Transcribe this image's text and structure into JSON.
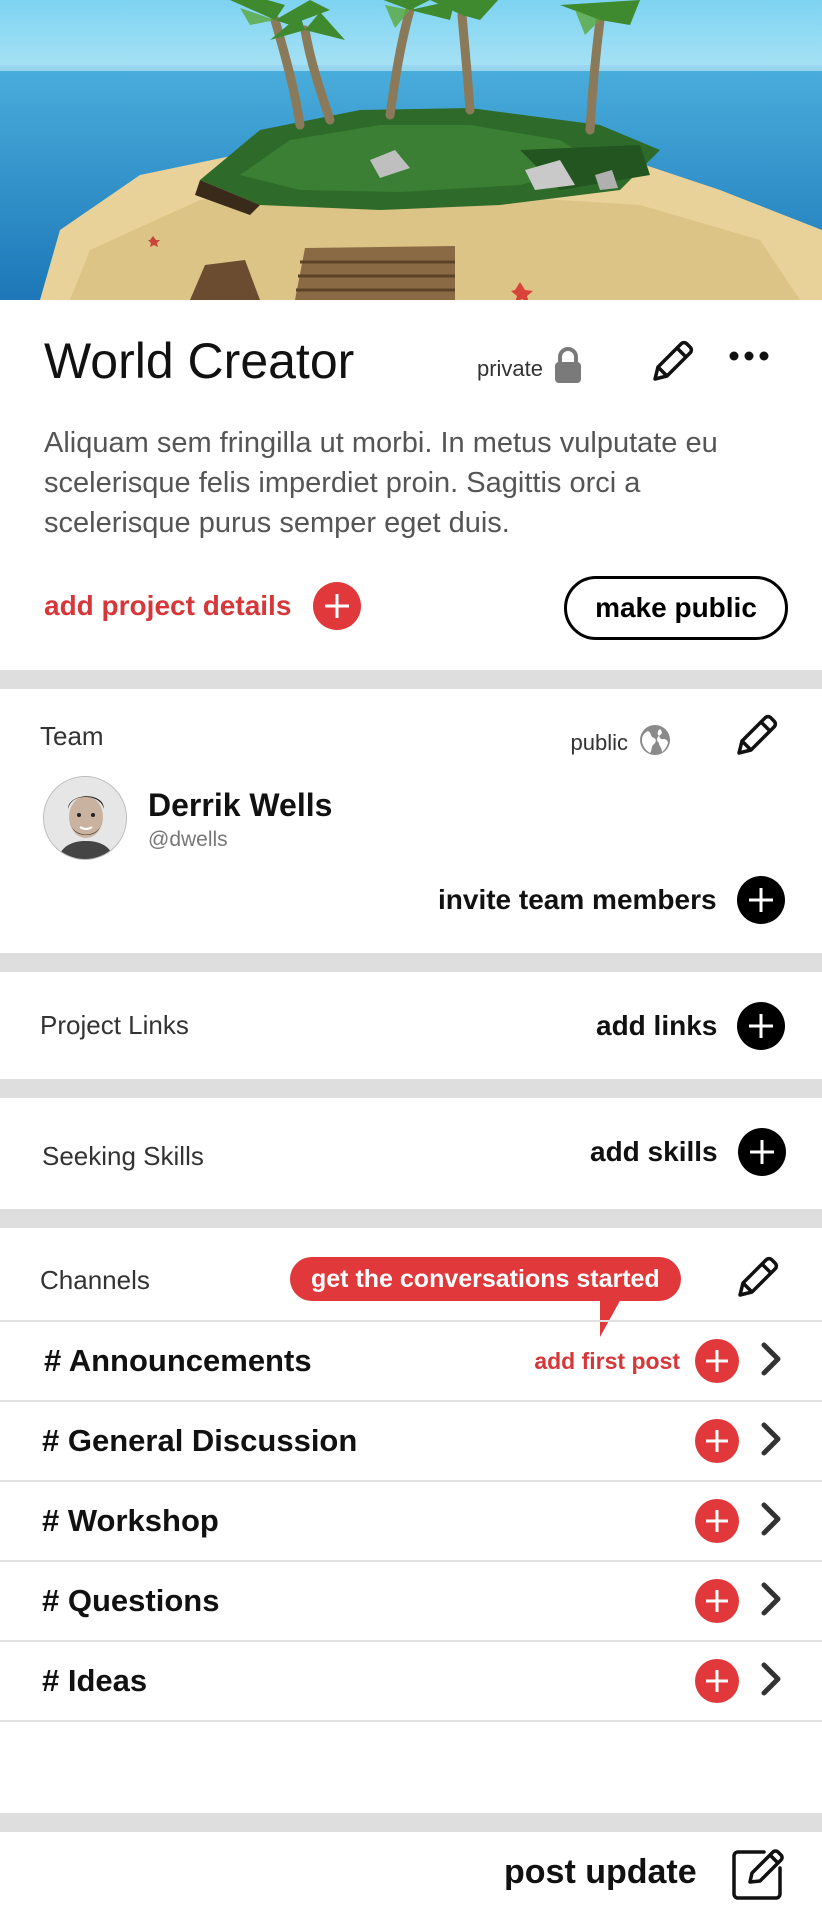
{
  "project": {
    "title": "World Creator",
    "visibility_label": "private",
    "description": "Aliquam sem fringilla ut morbi. In metus vulputate eu scelerisque felis imperdiet proin. Sagittis orci a scelerisque purus semper eget duis.",
    "add_details_label": "add project details",
    "make_public_label": "make public"
  },
  "team": {
    "label": "Team",
    "visibility_label": "public",
    "member_name": "Derrik Wells",
    "member_handle": "@dwells",
    "invite_label": "invite team members"
  },
  "links": {
    "label": "Project Links",
    "add_label": "add links"
  },
  "skills": {
    "label": "Seeking Skills",
    "add_label": "add skills"
  },
  "channels": {
    "label": "Channels",
    "tooltip": "get the conversations started",
    "first_post_label": "add first post",
    "items": [
      {
        "name": "# Announcements"
      },
      {
        "name": "# General Discussion"
      },
      {
        "name": "# Workshop"
      },
      {
        "name": "# Questions"
      },
      {
        "name": "# Ideas"
      }
    ]
  },
  "footer": {
    "post_update_label": "post update"
  },
  "colors": {
    "accent_red": "#e0383b",
    "divider_gray": "#dedede",
    "text_dark": "#111111"
  },
  "icons": [
    "lock-icon",
    "pencil-icon",
    "more-icon",
    "plus-icon",
    "globe-icon",
    "chevron-right-icon",
    "compose-icon"
  ]
}
